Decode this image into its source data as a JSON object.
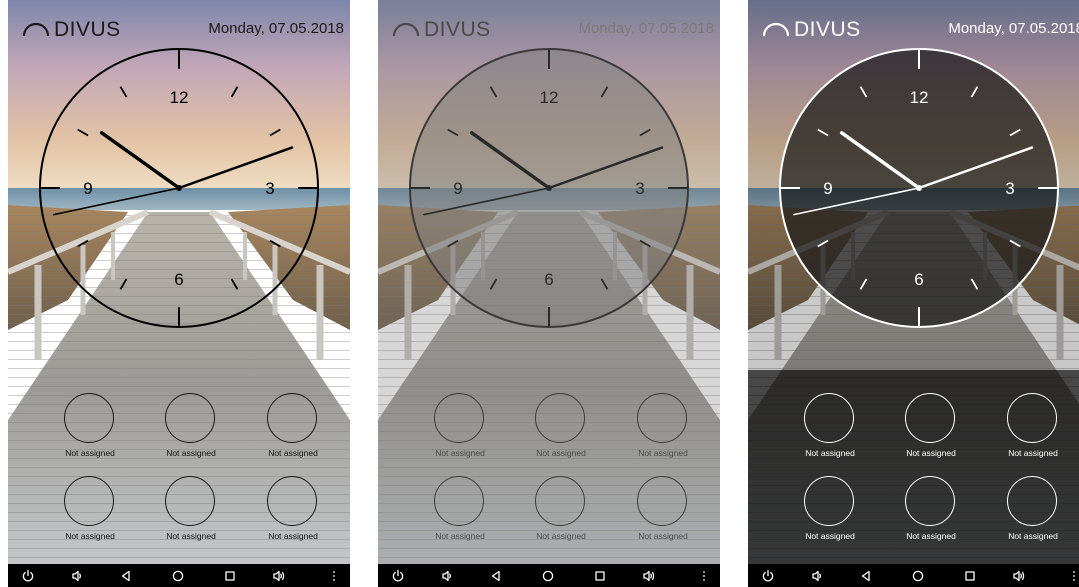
{
  "screens": [
    {
      "theme": "transparent",
      "logo_text": "DIVUS",
      "date": "Monday, 07.05.2018",
      "clock": {
        "numerals": [
          "12",
          "3",
          "6",
          "9"
        ],
        "time": "10:11:43",
        "face_color": "none",
        "ring_color": "#000000",
        "hand_color": "#000000"
      },
      "tiles": [
        {
          "label": "Not assigned"
        },
        {
          "label": "Not assigned"
        },
        {
          "label": "Not assigned"
        },
        {
          "label": "Not assigned"
        },
        {
          "label": "Not assigned"
        },
        {
          "label": "Not assigned"
        }
      ]
    },
    {
      "theme": "grey-tint",
      "logo_text": "DIVUS",
      "date": "Monday, 07.05.2018",
      "clock": {
        "numerals": [
          "12",
          "3",
          "6",
          "9"
        ],
        "time": "10:11:43",
        "face_color": "#808080",
        "ring_color": "#3a3a3a",
        "hand_color": "#2a2a2a"
      },
      "tiles": [
        {
          "label": "Not assigned"
        },
        {
          "label": "Not assigned"
        },
        {
          "label": "Not assigned"
        },
        {
          "label": "Not assigned"
        },
        {
          "label": "Not assigned"
        },
        {
          "label": "Not assigned"
        }
      ]
    },
    {
      "theme": "dark",
      "logo_text": "DIVUS",
      "date": "Monday, 07.05.2018",
      "clock": {
        "numerals": [
          "12",
          "3",
          "6",
          "9"
        ],
        "time": "10:11:43",
        "face_color": "#1a1a1a",
        "ring_color": "#ffffff",
        "hand_color": "#ffffff"
      },
      "tiles": [
        {
          "label": "Not assigned"
        },
        {
          "label": "Not assigned"
        },
        {
          "label": "Not assigned"
        },
        {
          "label": "Not assigned"
        },
        {
          "label": "Not assigned"
        },
        {
          "label": "Not assigned"
        }
      ]
    }
  ],
  "navbar_icons": [
    "power-icon",
    "volume-down-icon",
    "back-icon",
    "home-icon",
    "recent-apps-icon",
    "volume-up-icon",
    "more-options-icon"
  ]
}
